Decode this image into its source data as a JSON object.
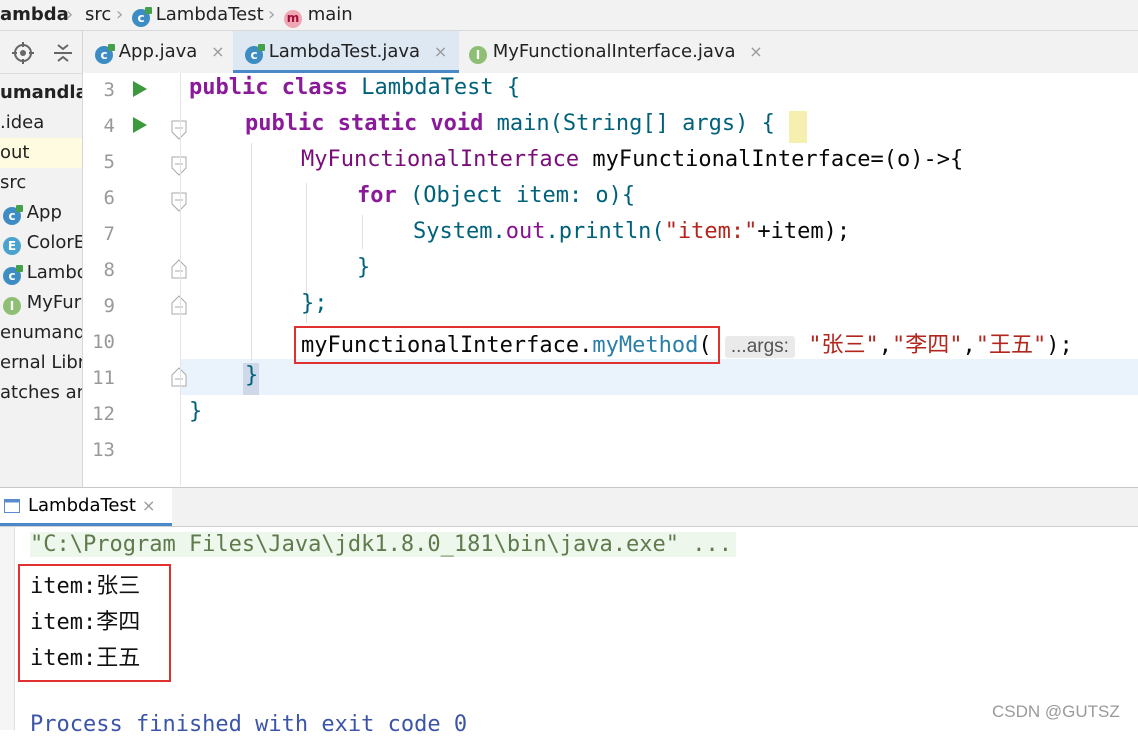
{
  "breadcrumb": {
    "project": "ambda",
    "src": "src",
    "class": "LambdaTest",
    "method": "main",
    "class_icon_letter": "c",
    "method_icon_letter": "m"
  },
  "sidebar": {
    "items": [
      {
        "label": "umandlar",
        "icon": ""
      },
      {
        "label": ".idea",
        "icon": ""
      },
      {
        "label": "out",
        "icon": ""
      },
      {
        "label": "src",
        "icon": ""
      },
      {
        "label": "App",
        "icon": "class-icon",
        "letter": "c"
      },
      {
        "label": "ColorE",
        "icon": "enum-icon",
        "letter": "E"
      },
      {
        "label": "Lambo",
        "icon": "class-icon",
        "letter": "c"
      },
      {
        "label": "MyFur",
        "icon": "interface-icon",
        "letter": "I"
      },
      {
        "label": "enumand",
        "icon": ""
      },
      {
        "label": "ernal Libr",
        "icon": ""
      },
      {
        "label": "atches an",
        "icon": ""
      }
    ]
  },
  "tabs": [
    {
      "label": "App.java",
      "letter": "c",
      "active": false
    },
    {
      "label": "LambdaTest.java",
      "letter": "c",
      "active": true
    },
    {
      "label": "MyFunctionalInterface.java",
      "letter": "I",
      "active": false
    }
  ],
  "tab_close": "×",
  "editor": {
    "line_numbers": [
      "3",
      "4",
      "5",
      "6",
      "7",
      "8",
      "9",
      "10",
      "11",
      "12",
      "13"
    ],
    "lines": {
      "l3_kw1": "public",
      "l3_kw2": "class",
      "l3_name": "LambdaTest {",
      "l4_kw": "public static void",
      "l4_rest": "main(String[] args) {",
      "l5_type": "MyFunctionalInterface",
      "l5_rest": "myFunctionalInterface=(o)->{",
      "l6_kw": "for",
      "l6_rest": "(Object item: o){",
      "l7_obj": "System.",
      "l7_field": "out",
      "l7_method": ".println(",
      "l7_str": "\"item:\"",
      "l7_rest": "+item);",
      "l8": "}",
      "l9": "};",
      "l10_obj": "myFunctionalInterface.",
      "l10_method": "myMethod",
      "l10_paren": "(",
      "l10_hint": "...args:",
      "l10_s1": "\"张三\"",
      "l10_c1": ",",
      "l10_s2": "\"李四\"",
      "l10_c2": ",",
      "l10_s3": "\"王五\"",
      "l10_end": ");",
      "l11": "}",
      "l12": "}"
    }
  },
  "console": {
    "tab_label": "LambdaTest",
    "command": "\"C:\\Program Files\\Java\\jdk1.8.0_181\\bin\\java.exe\" ...",
    "output": [
      "item:张三",
      "item:李四",
      "item:王五"
    ],
    "exit": "Process finished with exit code 0"
  },
  "watermark": "CSDN @GUTSZ",
  "colors": {
    "keyword": "#871094",
    "string": "#b3261e",
    "highlight_box": "#e03030",
    "current_line": "#eaf2fc",
    "accent": "#4a88c7"
  }
}
